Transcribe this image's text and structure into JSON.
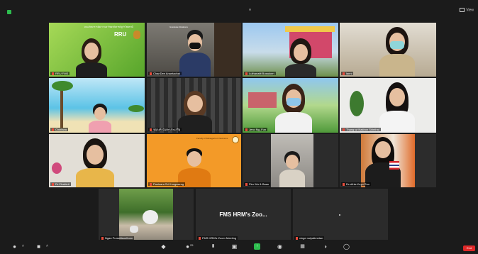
{
  "meeting": {
    "view_label": "View",
    "center_name": "FMS HRM's Zoo...",
    "end_label": "End"
  },
  "tiles": [
    {
      "name": "RRU FMS",
      "banner_text": "คณะวิทยาการจัดการ มหาวิทยาลัยราชภัฏรำไพพรรณี",
      "logo_text": "RRU"
    },
    {
      "name": "ChanDee Anantachai",
      "caption": "Graduate Relations"
    },
    {
      "name": "Luthanatit Busakorn"
    },
    {
      "name": "lanni"
    },
    {
      "name": "Chintana"
    },
    {
      "name": "จตุรงค์ นันทะประเสริฐ"
    },
    {
      "name": "Jeno Ng_Fun"
    },
    {
      "name": "Thang wi Nakhon Sirinthai"
    },
    {
      "name": "Dr.Chakkrit"
    },
    {
      "name": "Panisara Sri Kongsaeng",
      "header_text": "Faculty of Management Sciences"
    },
    {
      "name": "Pim Wu & Baan"
    },
    {
      "name": "Dr.nithis Keyo Run"
    },
    {
      "name": "Ngan Punwittsonthorn"
    },
    {
      "name": "FMS HRM's Zoom Meeting"
    },
    {
      "name": "vinge nuiyatimetan"
    }
  ],
  "toolbar": [
    {
      "id": "mute",
      "icon": "microphone-icon"
    },
    {
      "id": "video",
      "icon": "video-camera-icon"
    },
    {
      "id": "security",
      "icon": "shield-icon"
    },
    {
      "id": "participants",
      "icon": "participants-icon",
      "count": "25"
    },
    {
      "id": "polls",
      "icon": "bar-chart-icon"
    },
    {
      "id": "chat",
      "icon": "chat-icon"
    },
    {
      "id": "share",
      "icon": "share-screen-icon"
    },
    {
      "id": "record",
      "icon": "record-icon"
    },
    {
      "id": "apps",
      "icon": "apps-icon"
    },
    {
      "id": "whiteboard",
      "icon": "whiteboard-icon"
    },
    {
      "id": "reactions",
      "icon": "reactions-icon"
    }
  ],
  "colors": {
    "speaker_border": "#f1c232",
    "share_green": "#2dbd4e",
    "end_red": "#e02828"
  }
}
